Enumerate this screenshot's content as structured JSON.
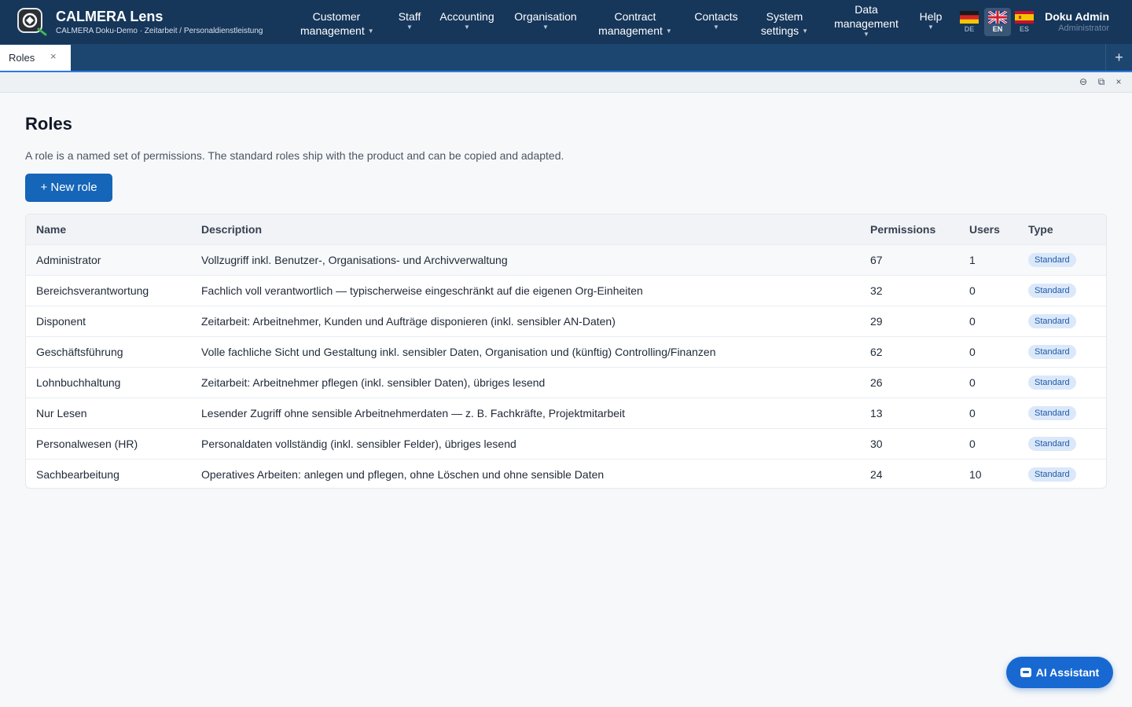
{
  "brand": {
    "title": "CALMERA Lens",
    "subtitle": "CALMERA Doku-Demo · Zeitarbeit / Personaldienstleistung"
  },
  "nav": [
    {
      "line1": "Customer",
      "line2": "management"
    },
    {
      "line1": "Staff",
      "line2": ""
    },
    {
      "line1": "Accounting",
      "line2": ""
    },
    {
      "line1": "Organisation",
      "line2": ""
    },
    {
      "line1": "Contract",
      "line2": "management"
    },
    {
      "line1": "Contacts",
      "line2": ""
    },
    {
      "line1": "System",
      "line2": "settings"
    },
    {
      "line1": "Data",
      "line2": "management"
    },
    {
      "line1": "Help",
      "line2": ""
    }
  ],
  "languages": [
    {
      "code": "DE",
      "active": false
    },
    {
      "code": "EN",
      "active": true
    },
    {
      "code": "ES",
      "active": false
    }
  ],
  "user": {
    "name": "Doku Admin",
    "role": "Administrator"
  },
  "tabs": [
    {
      "label": "Roles",
      "close": "×"
    }
  ],
  "tab_add": "+",
  "window_controls": {
    "minimize": "⊖",
    "restore": "⧉",
    "close": "×"
  },
  "page": {
    "title": "Roles",
    "description": "A role is a named set of permissions. The standard roles ship with the product and can be copied and adapted.",
    "new_button": "+ New role"
  },
  "table": {
    "columns": [
      "Name",
      "Description",
      "Permissions",
      "Users",
      "Type"
    ],
    "rows": [
      {
        "name": "Administrator",
        "description": "Vollzugriff inkl. Benutzer-, Organisations- und Archivverwaltung",
        "permissions": "67",
        "users": "1",
        "type": "Standard"
      },
      {
        "name": "Bereichsverantwortung",
        "description": "Fachlich voll verantwortlich — typischerweise eingeschränkt auf die eigenen Org-Einheiten",
        "permissions": "32",
        "users": "0",
        "type": "Standard"
      },
      {
        "name": "Disponent",
        "description": "Zeitarbeit: Arbeitnehmer, Kunden und Aufträge disponieren (inkl. sensibler AN-Daten)",
        "permissions": "29",
        "users": "0",
        "type": "Standard"
      },
      {
        "name": "Geschäftsführung",
        "description": "Volle fachliche Sicht und Gestaltung inkl. sensibler Daten, Organisation und (künftig) Controlling/Finanzen",
        "permissions": "62",
        "users": "0",
        "type": "Standard"
      },
      {
        "name": "Lohnbuchhaltung",
        "description": "Zeitarbeit: Arbeitnehmer pflegen (inkl. sensibler Daten), übriges lesend",
        "permissions": "26",
        "users": "0",
        "type": "Standard"
      },
      {
        "name": "Nur Lesen",
        "description": "Lesender Zugriff ohne sensible Arbeitnehmerdaten — z. B. Fachkräfte, Projektmitarbeit",
        "permissions": "13",
        "users": "0",
        "type": "Standard"
      },
      {
        "name": "Personalwesen (HR)",
        "description": "Personaldaten vollständig (inkl. sensibler Felder), übriges lesend",
        "permissions": "30",
        "users": "0",
        "type": "Standard"
      },
      {
        "name": "Sachbearbeitung",
        "description": "Operatives Arbeiten: anlegen und pflegen, ohne Löschen und ohne sensible Daten",
        "permissions": "24",
        "users": "10",
        "type": "Standard"
      }
    ]
  },
  "assistant": {
    "label": "AI Assistant"
  },
  "colors": {
    "topbar": "#16365a",
    "tabbar": "#1c4670",
    "accent": "#1565b8",
    "badge_bg": "#dbe8fa",
    "badge_text": "#1f5aa6"
  }
}
